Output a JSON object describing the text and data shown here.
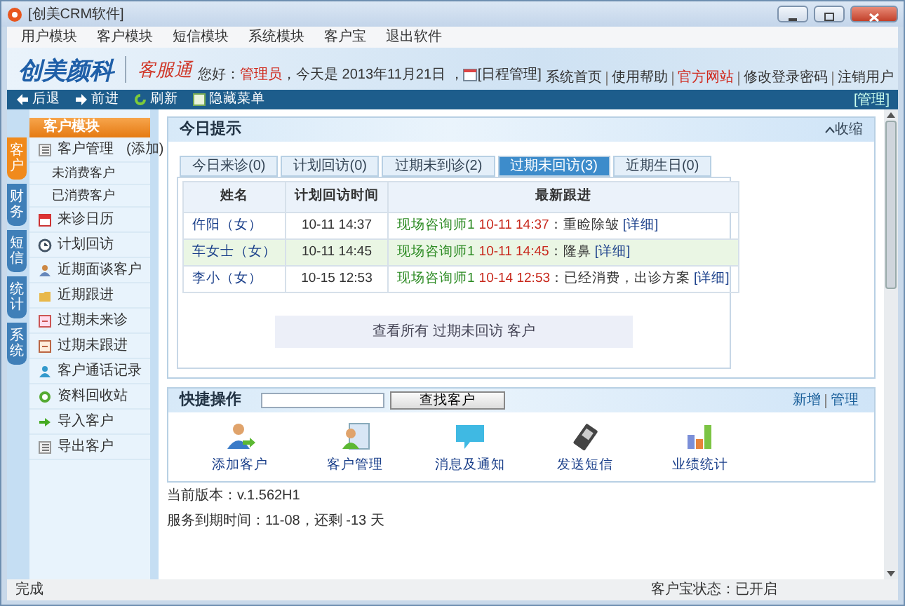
{
  "window": {
    "title": "[创美CRM软件]"
  },
  "menu": [
    "用户模块",
    "客户模块",
    "短信模块",
    "系统模块",
    "客户宝",
    "退出软件"
  ],
  "header": {
    "logo": "创美颜科",
    "product": "客服通",
    "greeting": "您好：",
    "user": "管理员",
    "date_text": "，今天是 2013年11月21日 ，",
    "schedule_link": "[日程管理]",
    "links": [
      {
        "label": "系统首页",
        "highlighted": false
      },
      {
        "label": "使用帮助",
        "highlighted": false
      },
      {
        "label": "官方网站",
        "highlighted": true
      },
      {
        "label": "修改登录密码",
        "highlighted": false
      },
      {
        "label": "注销用户",
        "highlighted": false
      }
    ]
  },
  "toolbar": {
    "buttons": [
      "后退",
      "前进",
      "刷新",
      "隐藏菜单"
    ],
    "manage": "[管理]"
  },
  "side_tabs": [
    {
      "label": "客户",
      "selected": true
    },
    {
      "label": "财务",
      "selected": false
    },
    {
      "label": "短信",
      "selected": false
    },
    {
      "label": "统计",
      "selected": false
    },
    {
      "label": "系统",
      "selected": false
    }
  ],
  "sidebar": {
    "title": "客户模块",
    "items": [
      {
        "kind": "main",
        "label": "客户管理",
        "extra": "(添加)"
      },
      {
        "kind": "sub",
        "label": "未消费客户"
      },
      {
        "kind": "sub",
        "label": "已消费客户"
      },
      {
        "kind": "main",
        "label": "来诊日历"
      },
      {
        "kind": "main",
        "label": "计划回访"
      },
      {
        "kind": "main",
        "label": "近期面谈客户"
      },
      {
        "kind": "main",
        "label": "近期跟进"
      },
      {
        "kind": "main",
        "label": "过期未来诊"
      },
      {
        "kind": "main",
        "label": "过期未跟进"
      },
      {
        "kind": "main",
        "label": "客户通话记录"
      },
      {
        "kind": "main",
        "label": "资料回收站"
      },
      {
        "kind": "main",
        "label": "导入客户"
      },
      {
        "kind": "main",
        "label": "导出客户"
      }
    ]
  },
  "today_panel": {
    "title": "今日提示",
    "collapse": "收缩",
    "tabs": [
      {
        "label": "今日来诊(0)",
        "selected": false
      },
      {
        "label": "计划回访(0)",
        "selected": false
      },
      {
        "label": "过期未到诊(2)",
        "selected": false
      },
      {
        "label": "过期未回访(3)",
        "selected": true
      },
      {
        "label": "近期生日(0)",
        "selected": false
      }
    ],
    "table": {
      "columns": [
        "姓名",
        "计划回访时间",
        "最新跟进"
      ],
      "rows": [
        {
          "name": "仵阳（女）",
          "time": "10-11 14:37",
          "staff": "现场咨询师1",
          "follow_time": "10-11 14:37",
          "note": "：重睑除皱",
          "link": "[详细]",
          "selected": false
        },
        {
          "name": "车女士（女）",
          "time": "10-11 14:45",
          "staff": "现场咨询师1",
          "follow_time": "10-11 14:45",
          "note": "：隆鼻",
          "link": "[详细]",
          "selected": true
        },
        {
          "name": "李小（女）",
          "time": "10-15 12:53",
          "staff": "现场咨询师1",
          "follow_time": "10-14 12:53",
          "note": "：已经消费，出诊方案",
          "link": "[详细]",
          "selected": false
        }
      ]
    },
    "view_all": "查看所有  过期未回访  客户"
  },
  "quick_panel": {
    "title": "快捷操作",
    "search_button": "查找客户",
    "links": [
      "新增",
      "管理"
    ],
    "actions": [
      "添加客户",
      "客户管理",
      "消息及通知",
      "发送短信",
      "业绩统计"
    ]
  },
  "version": "当前版本：v.1.562H1",
  "expiry": "服务到期时间：11-08，还剩 -13 天",
  "status_bar": {
    "left": "完成",
    "right": "客户宝状态：已开启"
  }
}
